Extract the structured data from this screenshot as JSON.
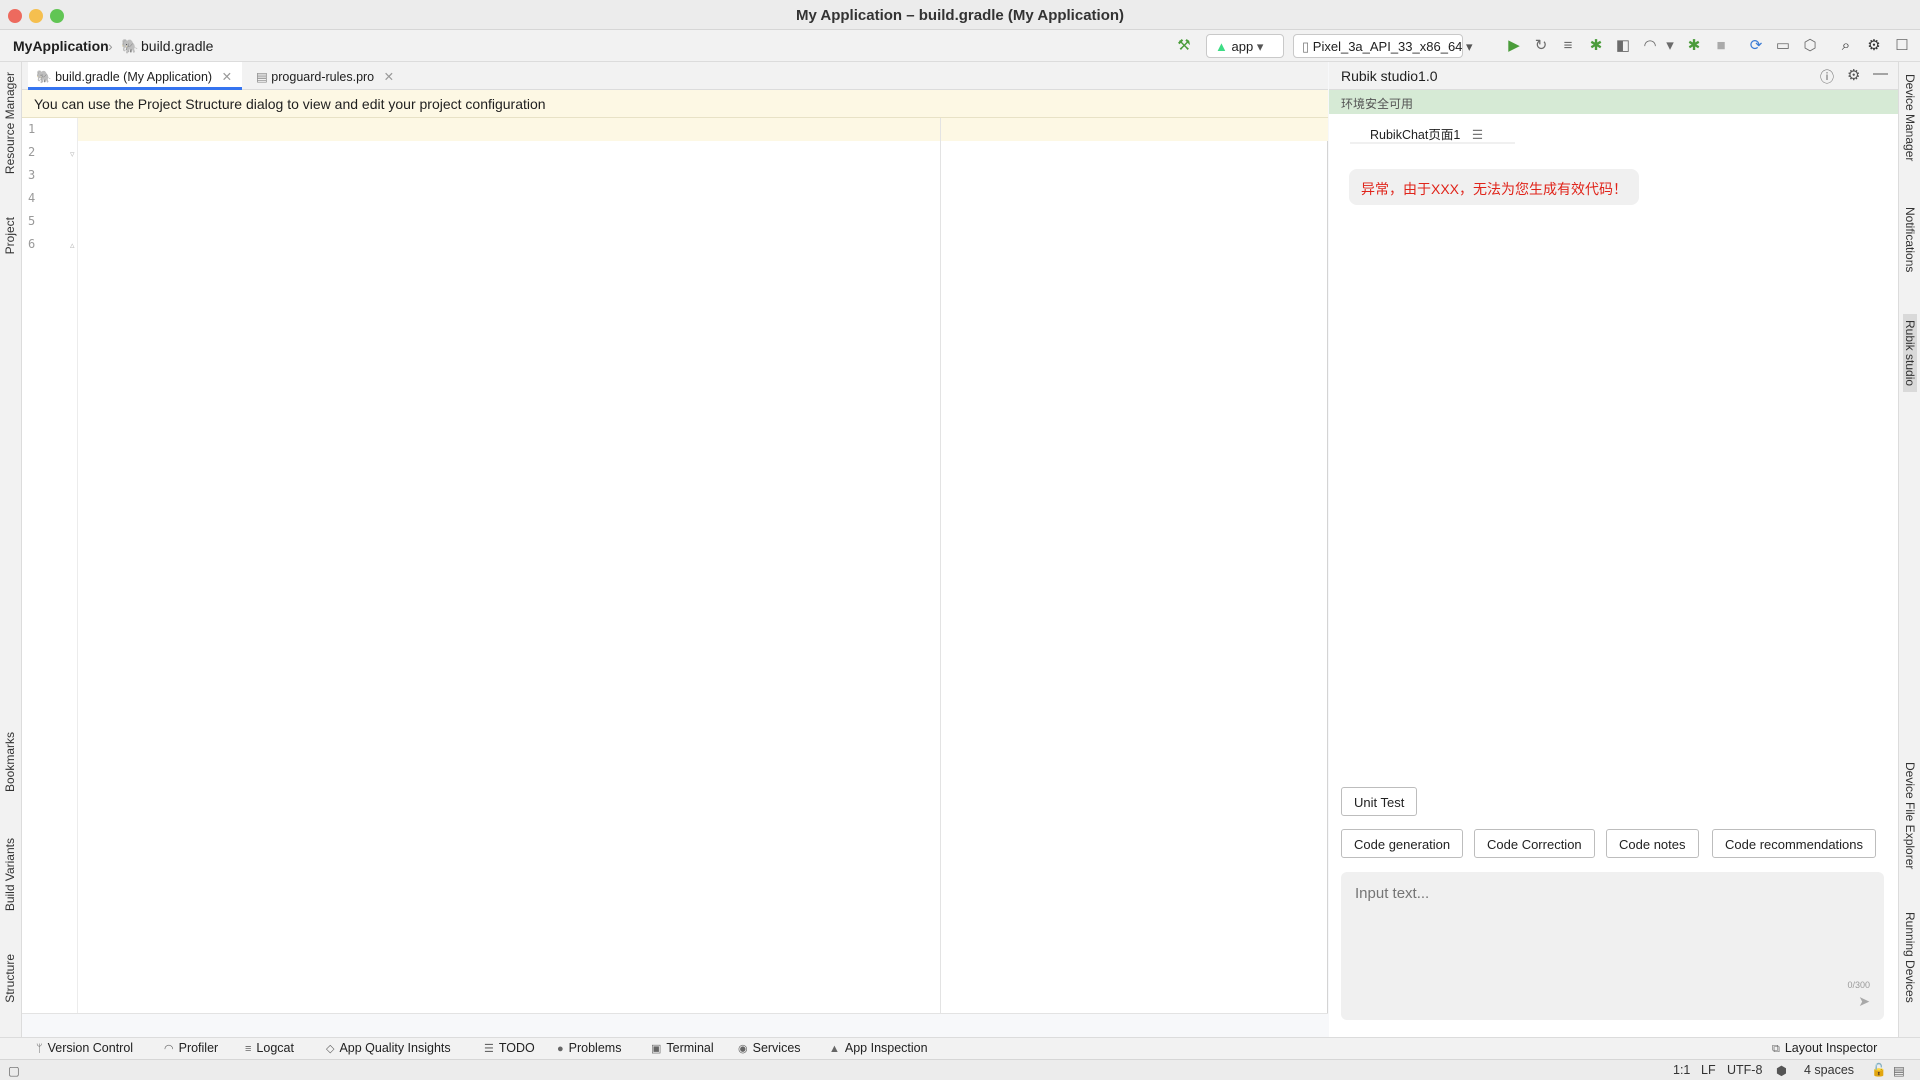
{
  "window": {
    "title": "My Application – build.gradle (My Application)"
  },
  "toolbar": {
    "project_name": "MyApplication",
    "breadcrumb_file": "build.gradle",
    "run_config": "app",
    "device": "Pixel_3a_API_33_x86_64"
  },
  "left_tools": [
    "Resource Manager",
    "Project",
    "Bookmarks",
    "Build Variants",
    "Structure"
  ],
  "right_tools": [
    "Device Manager",
    "Notifications",
    "Rubik studio",
    "Device File Explorer",
    "Running Devices"
  ],
  "editor": {
    "tabs": [
      {
        "label": "build.gradle (My Application)",
        "active": true
      },
      {
        "label": "proguard-rules.pro",
        "active": false
      }
    ],
    "banner": "You can use the Project Structure dialog to view and edit your project configuration",
    "line_numbers": [
      "1",
      "2",
      "3",
      "4",
      "5",
      "6"
    ]
  },
  "rubik": {
    "title": "Rubik studio1.0",
    "env_status": "环境安全可用",
    "chat_tab": "RubikChat页面1",
    "error_message": "异常，由于XXX，无法为您生成有效代码！",
    "actions_row1": [
      "Unit Test"
    ],
    "actions_row2": [
      "Code generation",
      "Code Correction",
      "Code notes",
      "Code recommendations"
    ],
    "input_placeholder": "Input text...",
    "char_count": "0/300"
  },
  "bottom_tools": [
    "Version Control",
    "Profiler",
    "Logcat",
    "App Quality Insights",
    "TODO",
    "Problems",
    "Terminal",
    "Services",
    "App Inspection"
  ],
  "layout_inspector": "Layout Inspector",
  "status": {
    "position": "1:1",
    "line_sep": "LF",
    "encoding": "UTF-8",
    "indent": "4 spaces"
  },
  "colors": {
    "accent": "#3574f0",
    "error": "#e0241a",
    "env_bg": "#d6ead5",
    "banner_bg": "#fdf8e4"
  }
}
